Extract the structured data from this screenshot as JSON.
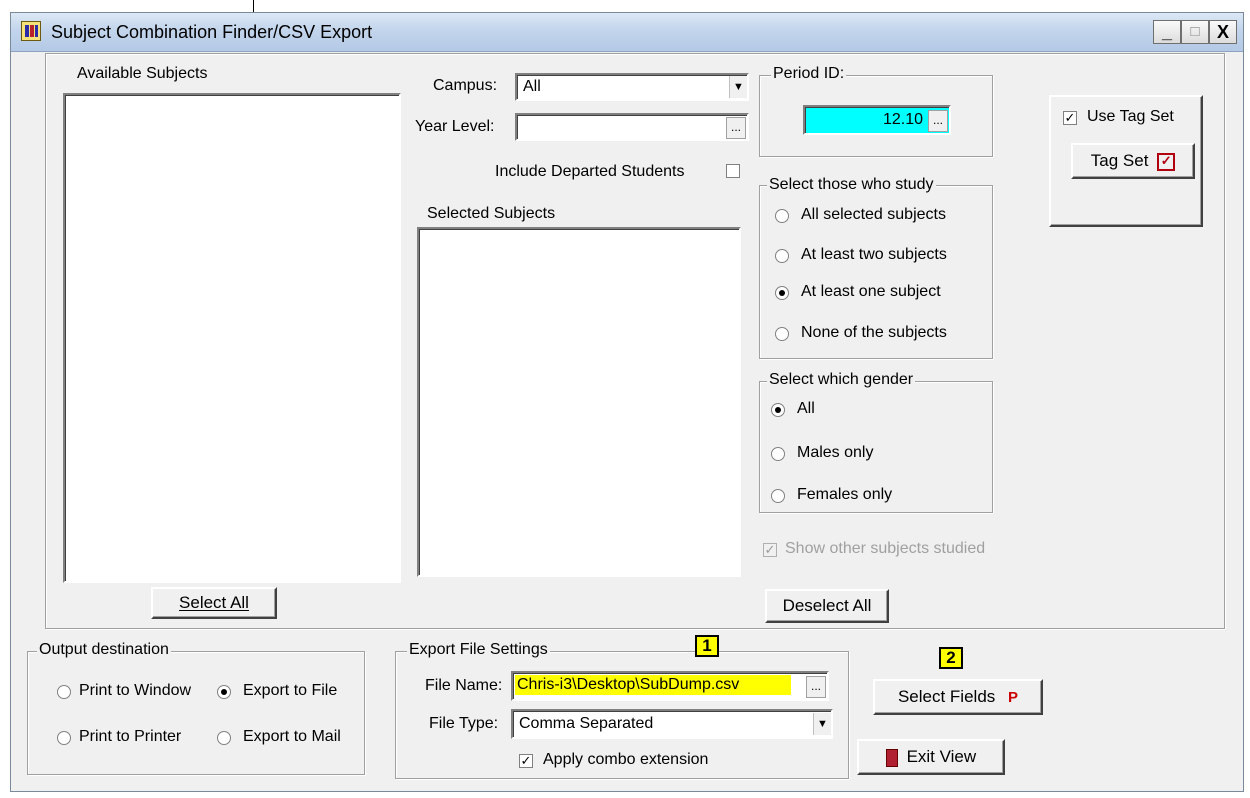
{
  "window": {
    "title": "Subject Combination Finder/CSV Export",
    "controls": {
      "minimize": "_",
      "maximize": "□",
      "close": "X"
    }
  },
  "available_subjects": {
    "label": "Available Subjects",
    "items": [],
    "select_all_label": "Select All"
  },
  "filters": {
    "campus_label": "Campus:",
    "campus_value": "All",
    "year_level_label": "Year Level:",
    "year_level_value": "",
    "include_departed_label": "Include Departed Students",
    "include_departed_checked": false
  },
  "selected_subjects": {
    "label": "Selected Subjects",
    "items": [],
    "deselect_all_label": "Deselect All"
  },
  "period": {
    "label": "Period ID:",
    "value": "12.10",
    "highlight_color": "#00ffff"
  },
  "tag_set": {
    "use_label": "Use Tag Set",
    "use_checked": true,
    "button_label": "Tag Set"
  },
  "study_group": {
    "label": "Select those who study",
    "options": [
      "All selected subjects",
      "At least two subjects",
      "At least one subject",
      "None of the subjects"
    ],
    "selected": "At least one subject"
  },
  "gender_group": {
    "label": "Select which gender",
    "options": [
      "All",
      "Males only",
      "Females only"
    ],
    "selected": "All"
  },
  "show_other": {
    "label": "Show other subjects studied",
    "checked": true,
    "disabled": true
  },
  "output": {
    "label": "Output destination",
    "options": [
      "Print to Window",
      "Export to File",
      "Print to Printer",
      "Export to Mail"
    ],
    "selected": "Export to File"
  },
  "export_settings": {
    "label": "Export  File Settings",
    "file_name_label": "File Name:",
    "file_name_value": "Chris-i3\\Desktop\\SubDump.csv",
    "file_name_highlight": "#ffff00",
    "file_type_label": "File Type:",
    "file_type_value": "Comma Separated",
    "apply_combo_label": "Apply combo extension",
    "apply_combo_checked": true
  },
  "buttons": {
    "select_fields": "Select Fields",
    "select_fields_badge": "P",
    "exit_view": "Exit View"
  },
  "annotations": {
    "badge1": "1",
    "badge2": "2"
  }
}
